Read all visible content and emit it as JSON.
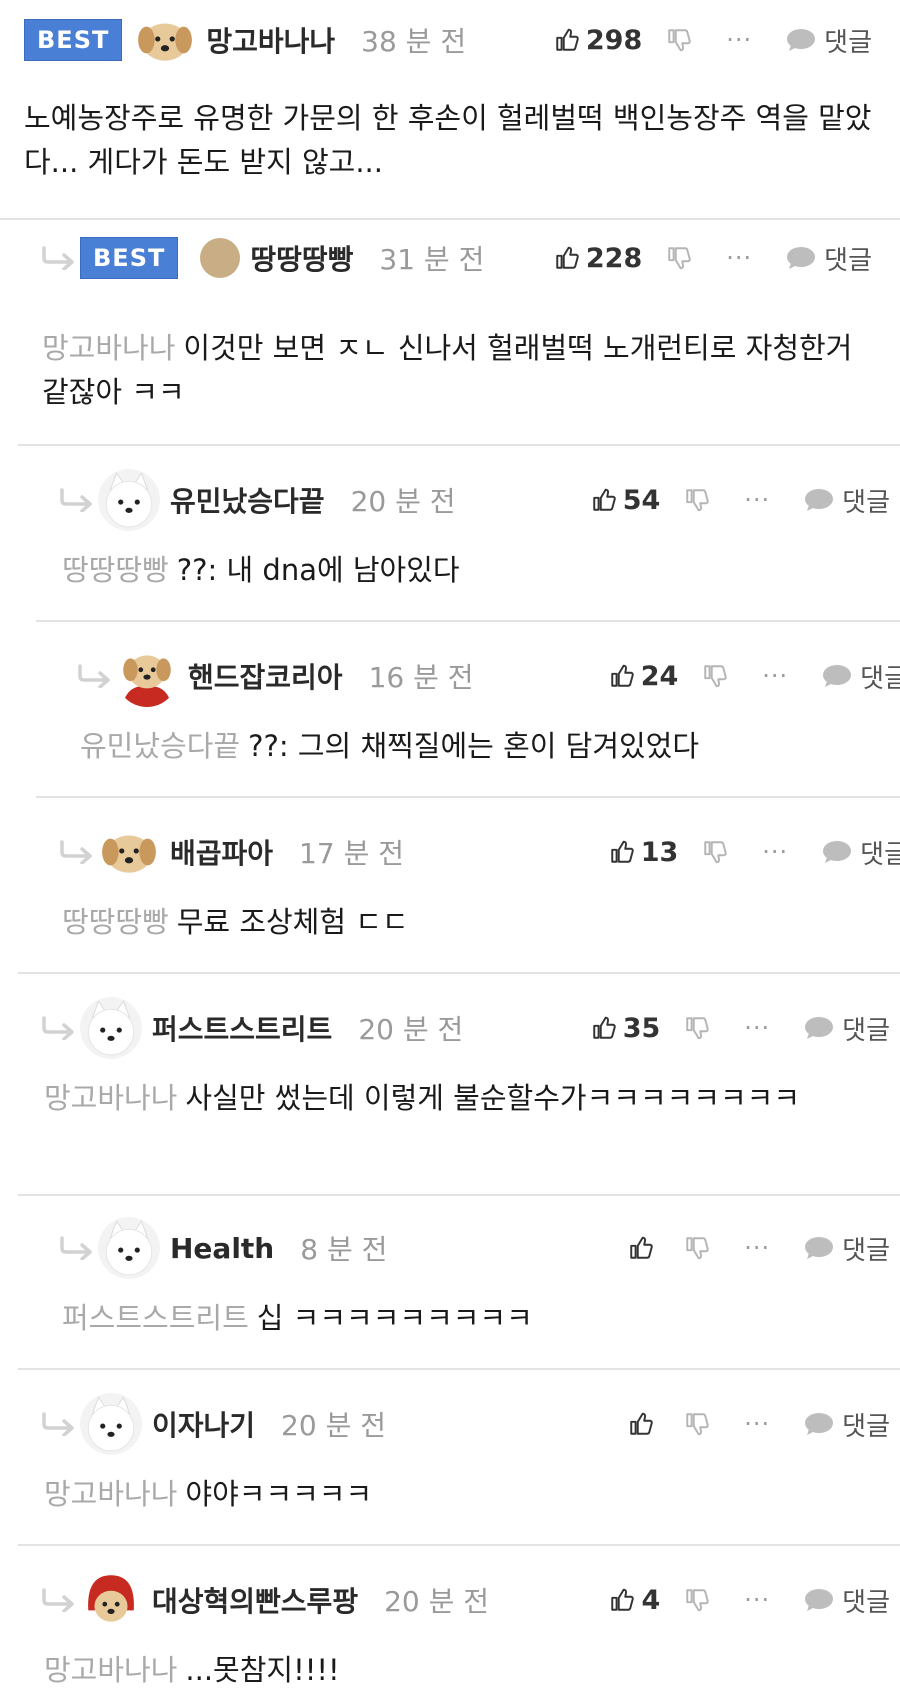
{
  "badge_label": "BEST",
  "reply_label": "댓글",
  "more_glyph": "···",
  "colors": {
    "badge": "#4a7fd6",
    "mention": "#a9a9a9",
    "divider": "#e4e4e4"
  },
  "comments": [
    {
      "user": "망고바나나",
      "time": "38 분 전",
      "likes": "298",
      "mention": "",
      "text": "노예농장주로 유명한 가문의 한 후손이 헐레벌떡 백인농장주 역을 맡았다... 게다가 돈도 받지 않고..."
    },
    {
      "user": "땅땅땅빵",
      "time": "31 분 전",
      "likes": "228",
      "mention": "망고바나나",
      "text": "이것만 보면 ㅈㄴ 신나서 헐래벌떡 노개런티로 자청한거같잖아 ㅋㅋ"
    },
    {
      "user": "유민났승다끝",
      "time": "20 분 전",
      "likes": "54",
      "mention": "땅땅땅빵",
      "text": "??: 내 dna에 남아있다"
    },
    {
      "user": "핸드잡코리아",
      "time": "16 분 전",
      "likes": "24",
      "mention": "유민났승다끝",
      "text": "??: 그의 채찍질에는 혼이 담겨있었다"
    },
    {
      "user": "배곱파아",
      "time": "17 분 전",
      "likes": "13",
      "mention": "땅땅땅빵",
      "text": "무료 조상체험 ㄷㄷ"
    },
    {
      "user": "퍼스트스트리트",
      "time": "20 분 전",
      "likes": "35",
      "mention": "망고바나나",
      "text": "사실만 썼는데 이렇게 불순할수가ㅋㅋㅋㅋㅋㅋㅋㅋ"
    },
    {
      "user": "Health",
      "time": "8 분 전",
      "likes": "",
      "mention": "퍼스트스트리트",
      "text": "십 ㅋㅋㅋㅋㅋㅋㅋㅋㅋ"
    },
    {
      "user": "이자나기",
      "time": "20 분 전",
      "likes": "",
      "mention": "망고바나나",
      "text": "야야ㅋㅋㅋㅋㅋ"
    },
    {
      "user": "대상혁의빤스루팡",
      "time": "20 분 전",
      "likes": "4",
      "mention": "망고바나나",
      "text": "...못참지!!!!"
    }
  ]
}
